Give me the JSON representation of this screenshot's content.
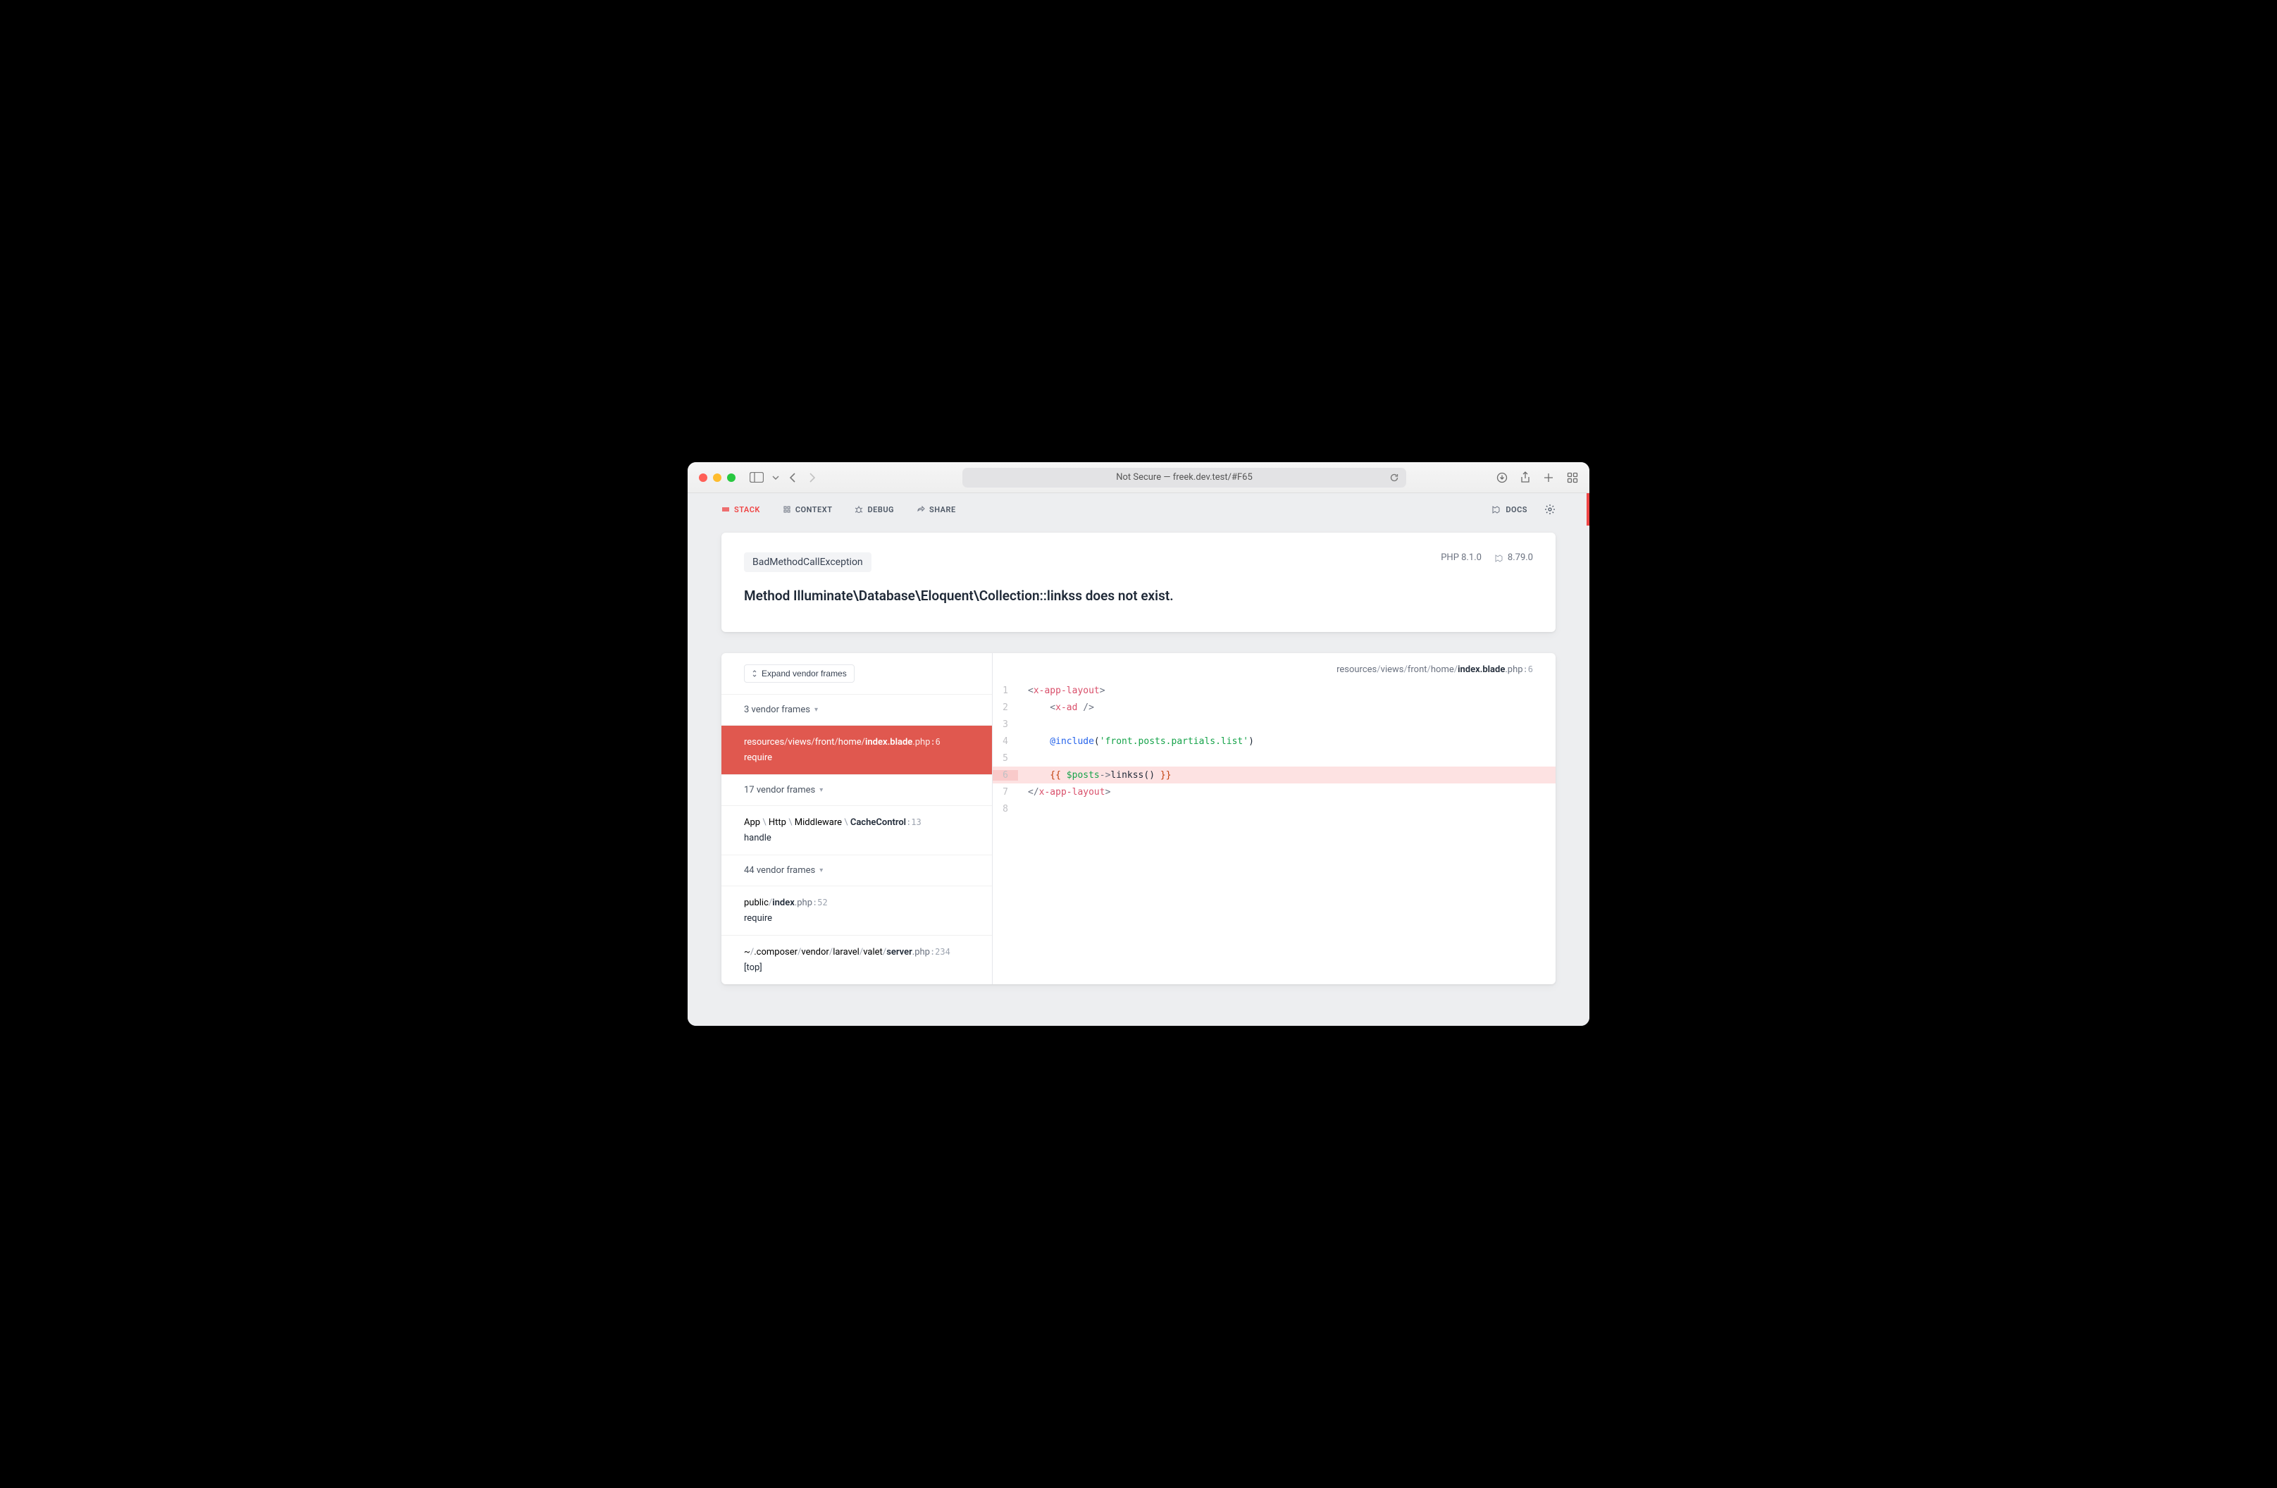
{
  "browser": {
    "address": "Not Secure — freek.dev.test/#F65"
  },
  "nav": {
    "stack": "STACK",
    "context": "CONTEXT",
    "debug": "DEBUG",
    "share": "SHARE",
    "docs": "DOCS"
  },
  "exception": {
    "class": "BadMethodCallException",
    "message": "Method Illuminate\\Database\\Eloquent\\Collection::linkss does not exist.",
    "php_version": "PHP 8.1.0",
    "laravel_version": "8.79.0"
  },
  "frames": {
    "expand_label": "Expand vendor frames",
    "group1": "3 vendor frames",
    "active": {
      "segs": [
        "resources",
        "views",
        "front",
        "home",
        "index.blade"
      ],
      "ext": ".php",
      "line": ":6",
      "sub": "require"
    },
    "group2": "17 vendor frames",
    "f2": {
      "segs": [
        "App",
        "Http",
        "Middleware",
        "CacheControl"
      ],
      "line": ":13",
      "sub": "handle"
    },
    "group3": "44 vendor frames",
    "f3": {
      "segs": [
        "public",
        "index"
      ],
      "ext": ".php",
      "line": ":52",
      "sub": "require"
    },
    "f4": {
      "segs": [
        "~",
        ".composer",
        "vendor",
        "laravel",
        "valet",
        "server"
      ],
      "ext": ".php",
      "line": ":234",
      "sub": "[top]"
    }
  },
  "code": {
    "path_segs": [
      "resources",
      "views",
      "front",
      "home",
      "index.blade"
    ],
    "path_ext": ".php",
    "path_line": ":6",
    "lines": {
      "l1": "1",
      "l2": "2",
      "l3": "3",
      "l4": "4",
      "l5": "5",
      "l6": "6",
      "l7": "7",
      "l8": "8",
      "t1a": "<",
      "t1b": "x-app-layout",
      "t1c": ">",
      "t2a": "    <",
      "t2b": "x-ad",
      "t2c": " />",
      "t4a": "    @include",
      "t4b": "(",
      "t4c": "'front.posts.partials.list'",
      "t4d": ")",
      "t6a": "    {{ ",
      "t6b": "$posts",
      "t6c": "->",
      "t6d": "linkss",
      "t6e": "()",
      "t6f": " }}",
      "t7a": "</",
      "t7b": "x-app-layout",
      "t7c": ">"
    }
  }
}
